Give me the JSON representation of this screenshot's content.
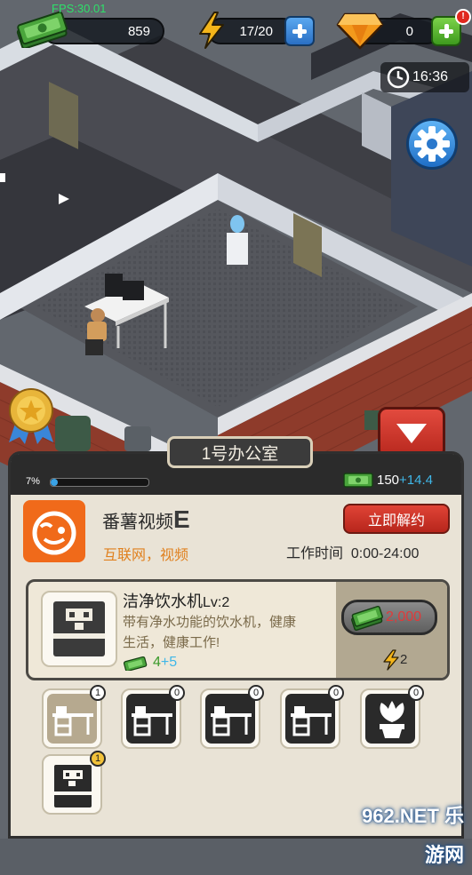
{
  "hud": {
    "fps": "FPS:30.01",
    "money": "859",
    "energy": "17/20",
    "gems": "0",
    "clock": "16:36"
  },
  "panel": {
    "tab_title": "1号办公室",
    "progress_text": "7%",
    "progress_fraction": 0.07,
    "income_base": "150",
    "income_bonus": "+14.4",
    "company": {
      "name": "番薯视频",
      "grade": "E",
      "tags": "互联网，视频",
      "unlock_label": "立即解约",
      "work_time_label": "工作时间",
      "work_time_value": "0:00-24:00"
    },
    "item": {
      "name": "洁净饮水机",
      "level": "Lv:2",
      "desc_line1": "带有净水功能的饮水机，健康",
      "desc_line2": "生活，健康工作!",
      "income_base": "4",
      "income_bonus": "+5",
      "price": "2,000",
      "energy_cost": "2"
    },
    "slots": [
      {
        "type": "desk",
        "count": "1",
        "active": true
      },
      {
        "type": "desk",
        "count": "0",
        "active": false
      },
      {
        "type": "desk",
        "count": "0",
        "active": false
      },
      {
        "type": "desk",
        "count": "0",
        "active": false
      },
      {
        "type": "plant",
        "count": "0",
        "active": false
      },
      {
        "type": "cooler",
        "count": "1",
        "active": false
      }
    ]
  },
  "watermark": "962.NET 乐游网",
  "colors": {
    "accent_blue": "#2a6fc4",
    "accent_green": "#3e9a1e",
    "unlock_red": "#c9302c",
    "progress_blue": "#3aa3e6",
    "income_bonus": "#3fb7e8",
    "brand_orange": "#f06a1a"
  },
  "icons": {
    "money": "cash-stack-icon",
    "energy": "lightning-icon",
    "gem": "diamond-icon",
    "clock": "clock-icon",
    "settings": "gear-icon",
    "collapse": "chevron-down-icon",
    "medal": "medal-icon"
  }
}
